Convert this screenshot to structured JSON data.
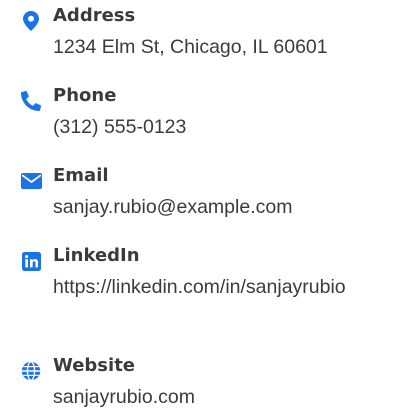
{
  "colors": {
    "accent": "#1a73e8",
    "text": "#3b3b3b",
    "background": "#ffffff"
  },
  "contact": {
    "items": [
      {
        "icon": "map-pin-icon",
        "label": "Address",
        "value": "1234 Elm St, Chicago, IL 60601"
      },
      {
        "icon": "phone-icon",
        "label": "Phone",
        "value": "(312) 555-0123"
      },
      {
        "icon": "envelope-icon",
        "label": "Email",
        "value": "sanjay.rubio@example.com"
      },
      {
        "icon": "linkedin-icon",
        "label": "LinkedIn",
        "value": "https://linkedin.com/in/sanjayrubio"
      },
      {
        "icon": "globe-icon",
        "label": "Website",
        "value": "sanjayrubio.com"
      }
    ]
  }
}
